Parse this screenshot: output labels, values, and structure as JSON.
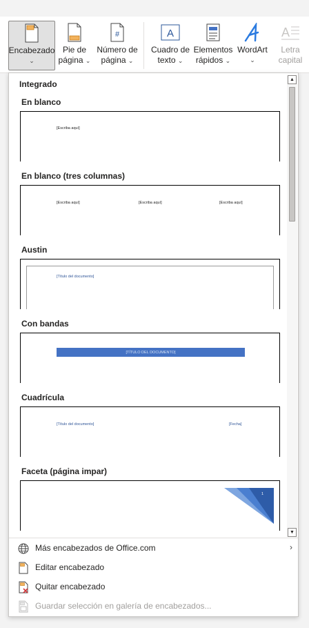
{
  "ribbon": {
    "header": {
      "label": "Encabezado",
      "chevron": "⌄"
    },
    "footer": {
      "label1": "Pie de",
      "label2": "página",
      "chevron": "⌄"
    },
    "page_number": {
      "label1": "Número de",
      "label2": "página",
      "chevron": "⌄"
    },
    "text_box": {
      "label1": "Cuadro de",
      "label2": "texto",
      "chevron": "⌄"
    },
    "quick_parts": {
      "label1": "Elementos",
      "label2": "rápidos",
      "chevron": "⌄"
    },
    "wordart": {
      "label": "WordArt",
      "chevron": "⌄"
    },
    "drop_cap": {
      "label1": "Letra",
      "label2": "capital"
    }
  },
  "gallery": {
    "category": "Integrado",
    "items": [
      {
        "title": "En blanco",
        "placeholders": [
          "[Escriba aquí]"
        ]
      },
      {
        "title": "En blanco (tres columnas)",
        "placeholders": [
          "[Escriba aquí]",
          "[Escriba aquí]",
          "[Escriba aquí]"
        ]
      },
      {
        "title": "Austin",
        "placeholders": [
          "[Título del documento]"
        ]
      },
      {
        "title": "Con bandas",
        "placeholders": [
          "[TÍTULO DEL DOCUMENTO]"
        ]
      },
      {
        "title": "Cuadrícula",
        "placeholders": [
          "[Título del documento]",
          "[Fecha]"
        ]
      },
      {
        "title": "Faceta (página impar)",
        "placeholders": [
          "1"
        ]
      }
    ]
  },
  "scroll": {
    "up": "▲",
    "down": "▼"
  },
  "menu": {
    "more": {
      "label": "Más encabezados de Office.com",
      "arrow": "›"
    },
    "edit": {
      "label": "Editar encabezado"
    },
    "remove": {
      "label": "Quitar encabezado"
    },
    "save": {
      "label": "Guardar selección en galería de encabezados..."
    }
  },
  "colors": {
    "accent": "#2b579a",
    "band": "#4472c4",
    "facet_dark": "#2e5ca8",
    "facet_light": "#7ea6e0"
  }
}
